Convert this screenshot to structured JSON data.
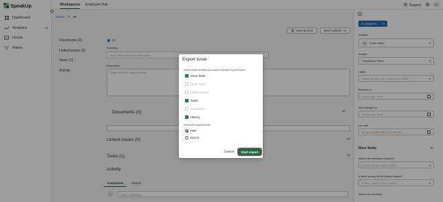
{
  "app": {
    "name": "SpeakUp"
  },
  "sidebar": {
    "items": [
      {
        "label": "Dashboard",
        "icon": "grid-icon"
      },
      {
        "label": "Analytics",
        "icon": "chart-icon",
        "expandable": true
      },
      {
        "label": "Issues",
        "icon": "inbox-icon"
      },
      {
        "label": "Filters",
        "icon": "filter-icon"
      }
    ]
  },
  "topbar": {
    "tabs": [
      {
        "label": "Workspaces",
        "active": true
      },
      {
        "label": "Employee Hub",
        "active": false
      }
    ],
    "support_label": "Support",
    "avatar_initials": "LL"
  },
  "breadcrumb": {
    "root": "Issues",
    "current": "68"
  },
  "main": {
    "issue_id": "68",
    "sections": [
      "Documents (0)",
      "Linked issues (0)",
      "Tasks (1)",
      "Activity"
    ],
    "user_access_label": "User access",
    "more_actions_label": "More actions",
    "summary_label": "Summary",
    "summary_placeholder": "Add a few words about this issue",
    "description_label": "Description",
    "description_placeholder": "Detail what the issue is about...",
    "documents_title": "Documents (0)",
    "linked_title": "Linked issues (0)",
    "tasks_title": "Tasks (1)",
    "activity_title": "Activity",
    "activity_tabs": [
      "Comments",
      "History"
    ],
    "comment_avatar": "LL",
    "comment_placeholder": "Add a comment..."
  },
  "right_panel": {
    "status": "In progress",
    "assignee_label": "Assignee",
    "assignee_initials": "LL",
    "assignee_value": "Lucia Lopez",
    "domain_label": "Domain*",
    "domain_value": "Compliance Team",
    "labels_label": "Labels",
    "labels_placeholder": "Select an option or create a new label",
    "received_label": "Received on",
    "received_placeholder": "Select date / time",
    "ack_label": "Acknowledged on",
    "ack_placeholder": "Select date / time",
    "due_label": "Due date",
    "due_value": "03 April 2026 00:00 (UTC+02:00)",
    "more_fields_label": "More fields",
    "q1_label": "What is the misconduct category?",
    "q1_placeholder": "Select / search option below",
    "q2_label": "In which country did the incident happen?",
    "q2_placeholder": "Select / search option below",
    "q3_label": "What is the conclusion"
  },
  "modal": {
    "title": "Export issue",
    "subtitle": "Select which sections you want to include in your export.",
    "options": [
      {
        "label": "Issue fields",
        "checked": true,
        "disabled": false
      },
      {
        "label": "Issue forms",
        "checked": false,
        "disabled": true
      },
      {
        "label": "Linked issues",
        "checked": false,
        "disabled": true
      },
      {
        "label": "Tasks",
        "checked": true,
        "disabled": false
      },
      {
        "label": "Comments",
        "checked": false,
        "disabled": true
      },
      {
        "label": "History",
        "checked": true,
        "disabled": false
      }
    ],
    "format_label": "Select the export format.",
    "formats": [
      {
        "label": "PDF",
        "selected": true
      },
      {
        "label": "DOCX",
        "selected": false
      }
    ],
    "cancel_label": "Cancel",
    "start_label": "Start export"
  },
  "colors": {
    "brand": "#1e6b45",
    "status": "#1f6fb5",
    "due_date": "#d97a10",
    "highlight": "#e23b3b"
  }
}
